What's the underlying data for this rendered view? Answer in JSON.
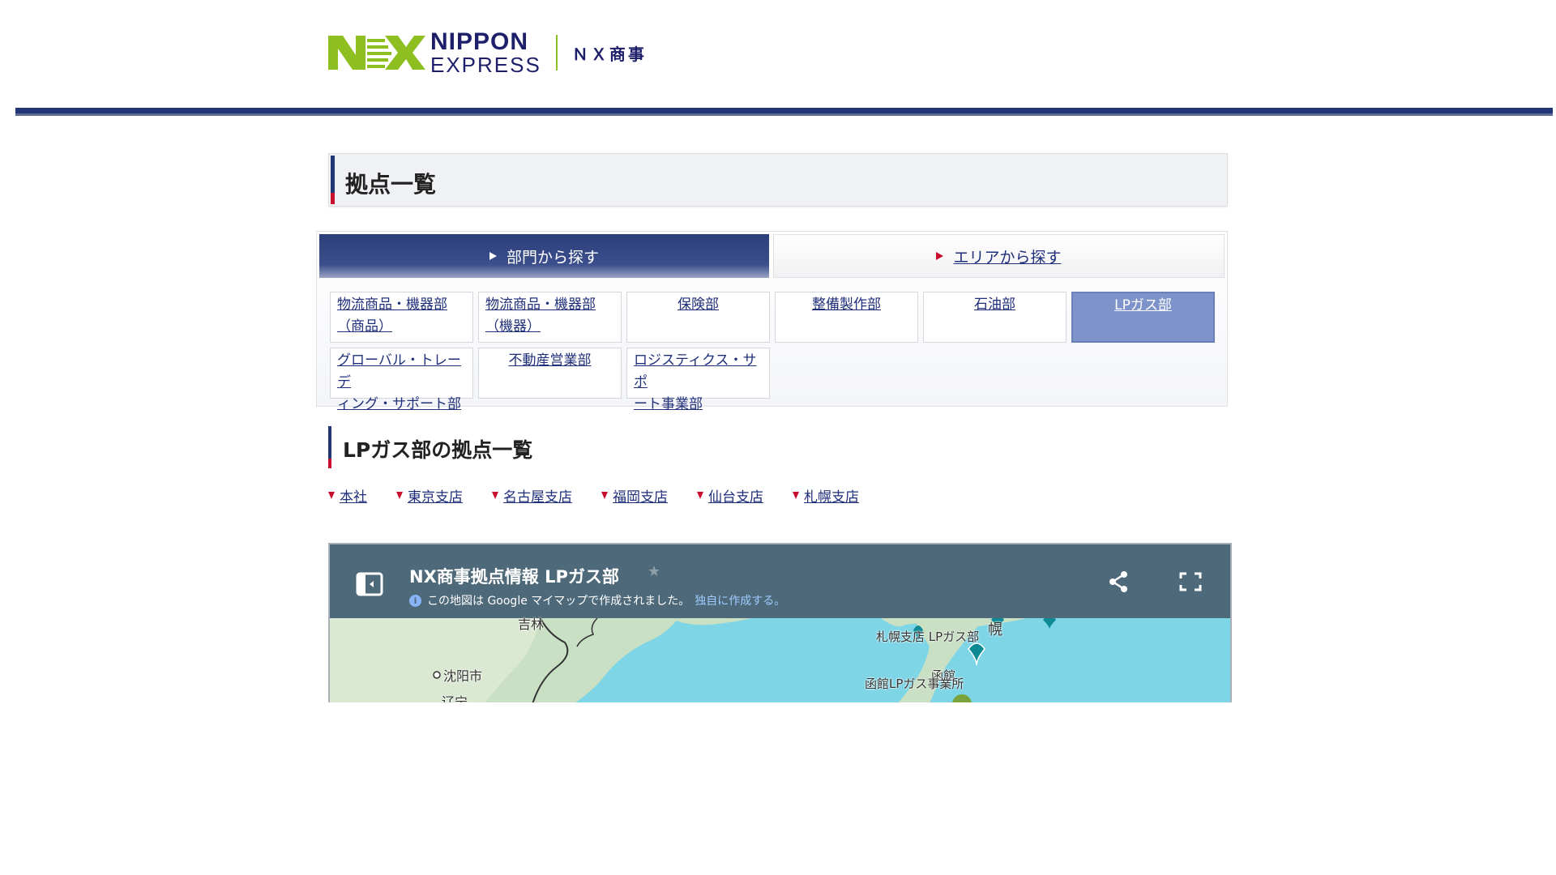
{
  "brand": {
    "name_line1": "NIPPON",
    "name_line2": "EXPRESS",
    "company": "ＮＸ商事",
    "colors": {
      "green": "#8cbf1f",
      "navy": "#1d1f6b",
      "bar": "#213775",
      "red": "#c8102e"
    }
  },
  "page": {
    "title": "拠点一覧"
  },
  "tabs": [
    {
      "label": "部門から探す",
      "active": true
    },
    {
      "label": "エリアから探す",
      "active": false
    }
  ],
  "departments": [
    {
      "label_line1": "物流商品・機器部",
      "label_line2": "（商品）",
      "selected": false
    },
    {
      "label_line1": "物流商品・機器部",
      "label_line2": "（機器）",
      "selected": false
    },
    {
      "label_line1": "保険部",
      "label_line2": "",
      "selected": false
    },
    {
      "label_line1": "整備製作部",
      "label_line2": "",
      "selected": false
    },
    {
      "label_line1": "石油部",
      "label_line2": "",
      "selected": false
    },
    {
      "label_line1": "LPガス部",
      "label_line2": "",
      "selected": true
    },
    {
      "label_line1": "グローバル・トレーデ",
      "label_line2": "ィング・サポート部",
      "selected": false
    },
    {
      "label_line1": "不動産営業部",
      "label_line2": "",
      "selected": false
    },
    {
      "label_line1": "ロジスティクス・サポ",
      "label_line2": "ート事業部",
      "selected": false
    }
  ],
  "section": {
    "title": "LPガス部の拠点一覧"
  },
  "anchors": [
    "本社",
    "東京支店",
    "名古屋支店",
    "福岡支店",
    "仙台支店",
    "札幌支店"
  ],
  "map": {
    "title": "NX商事拠点情報 LPガス部",
    "subtitle": "この地図は Google マイマップで作成されました。",
    "subtitle_link": "独自に作成する。",
    "labels": {
      "jilin": "吉林",
      "shenyang": "沈阳市",
      "liaoning": "辽宁",
      "sapporo_city": "幌",
      "sapporo_branch": "札幌支店 LPガス部",
      "hakodate_city": "函館",
      "hakodate_office": "函館LPガス事業所"
    },
    "icons": [
      "side-panel-icon",
      "star-icon",
      "info-icon",
      "share-icon",
      "fullscreen-icon",
      "map-pin-icon"
    ]
  }
}
